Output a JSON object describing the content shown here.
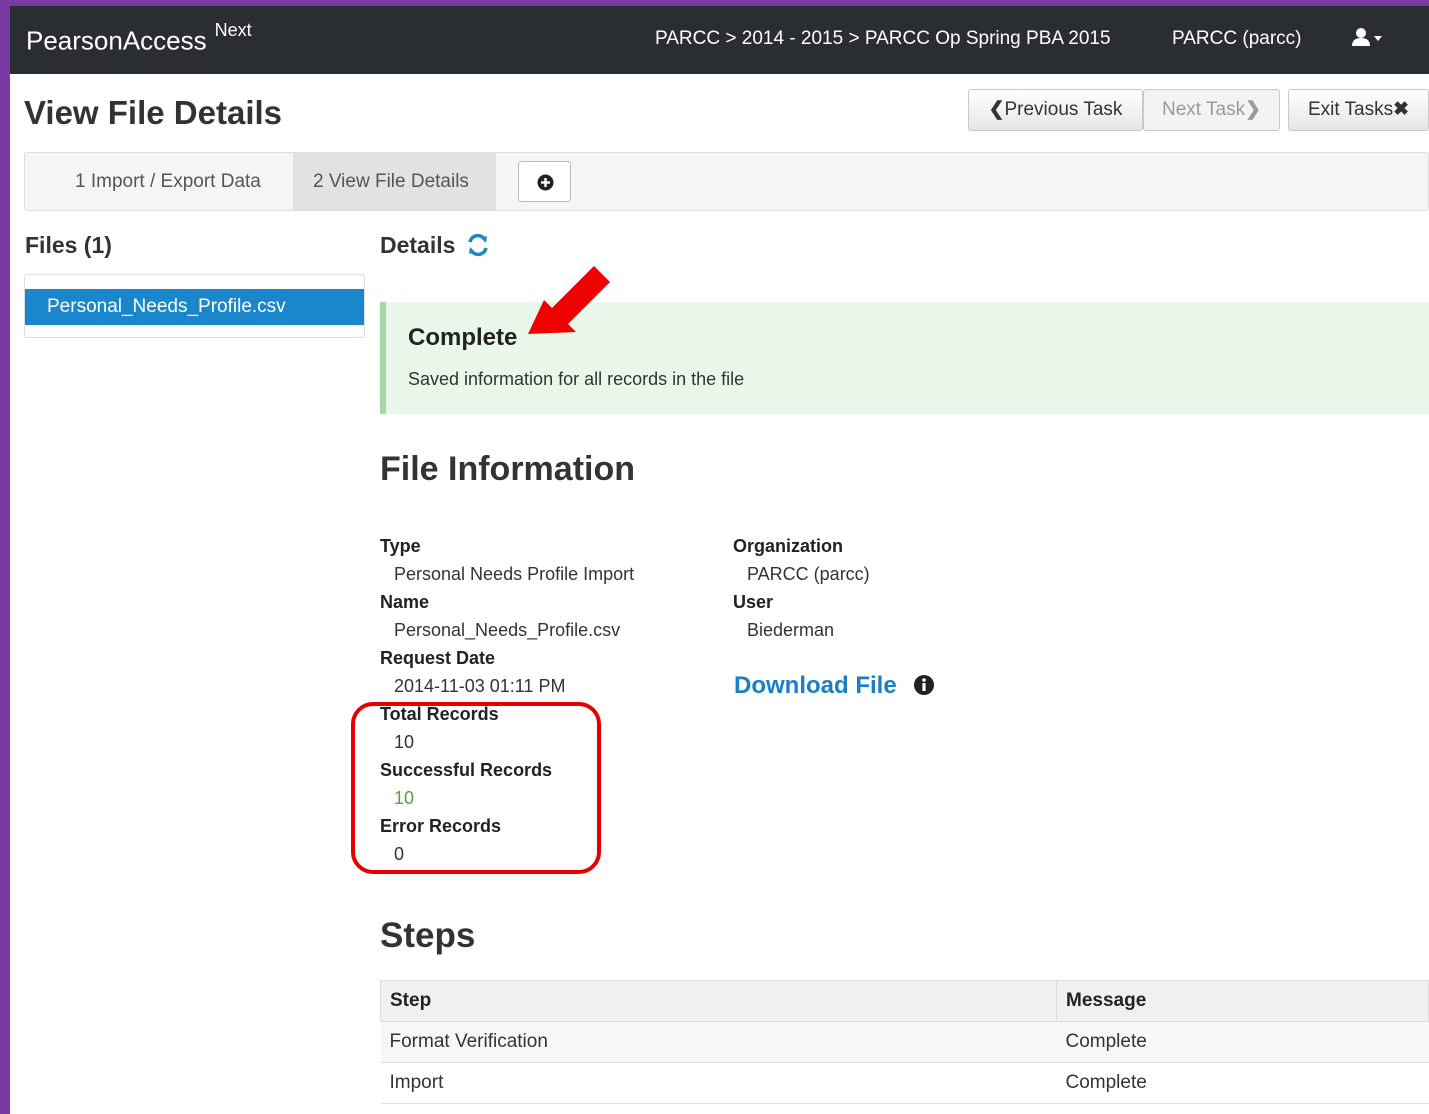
{
  "topbar": {
    "brand": "PearsonAccess",
    "brand_sup": "Next",
    "breadcrumb": "PARCC > 2014 - 2015 > PARCC Op Spring PBA 2015",
    "organization": "PARCC (parcc)",
    "user_icon": "user-icon"
  },
  "page": {
    "title": "View File Details",
    "previous_task": "Previous Task",
    "next_task": "Next Task",
    "exit_tasks": "Exit Tasks"
  },
  "tasks": [
    {
      "label": "1 Import / Export Data",
      "active": false
    },
    {
      "label": "2 View File Details",
      "active": true
    }
  ],
  "files": {
    "heading": "Files (1)",
    "items": [
      "Personal_Needs_Profile.csv"
    ]
  },
  "details": {
    "heading": "Details",
    "status_title": "Complete",
    "status_message": "Saved information for all records in the file"
  },
  "file_info": {
    "heading": "File Information",
    "left": [
      {
        "label": "Type",
        "value": "Personal Needs Profile Import"
      },
      {
        "label": "Name",
        "value": "Personal_Needs_Profile.csv"
      },
      {
        "label": "Request Date",
        "value": "2014-11-03 01:11 PM"
      },
      {
        "label": "Total Records",
        "value": "10"
      },
      {
        "label": "Successful Records",
        "value": "10"
      },
      {
        "label": "Error Records",
        "value": "0"
      }
    ],
    "right": [
      {
        "label": "Organization",
        "value": "PARCC (parcc)"
      },
      {
        "label": "User",
        "value": "Biederman"
      }
    ],
    "download": "Download File"
  },
  "steps": {
    "heading": "Steps",
    "columns": [
      "Step",
      "Message"
    ],
    "rows": [
      [
        "Format Verification",
        "Complete"
      ],
      [
        "Import",
        "Complete"
      ]
    ]
  },
  "colors": {
    "topbar": "#2b2e31",
    "accent_blue": "#1a87cc",
    "success_bg": "#e9f7ea",
    "annotation_red": "#e60000"
  }
}
